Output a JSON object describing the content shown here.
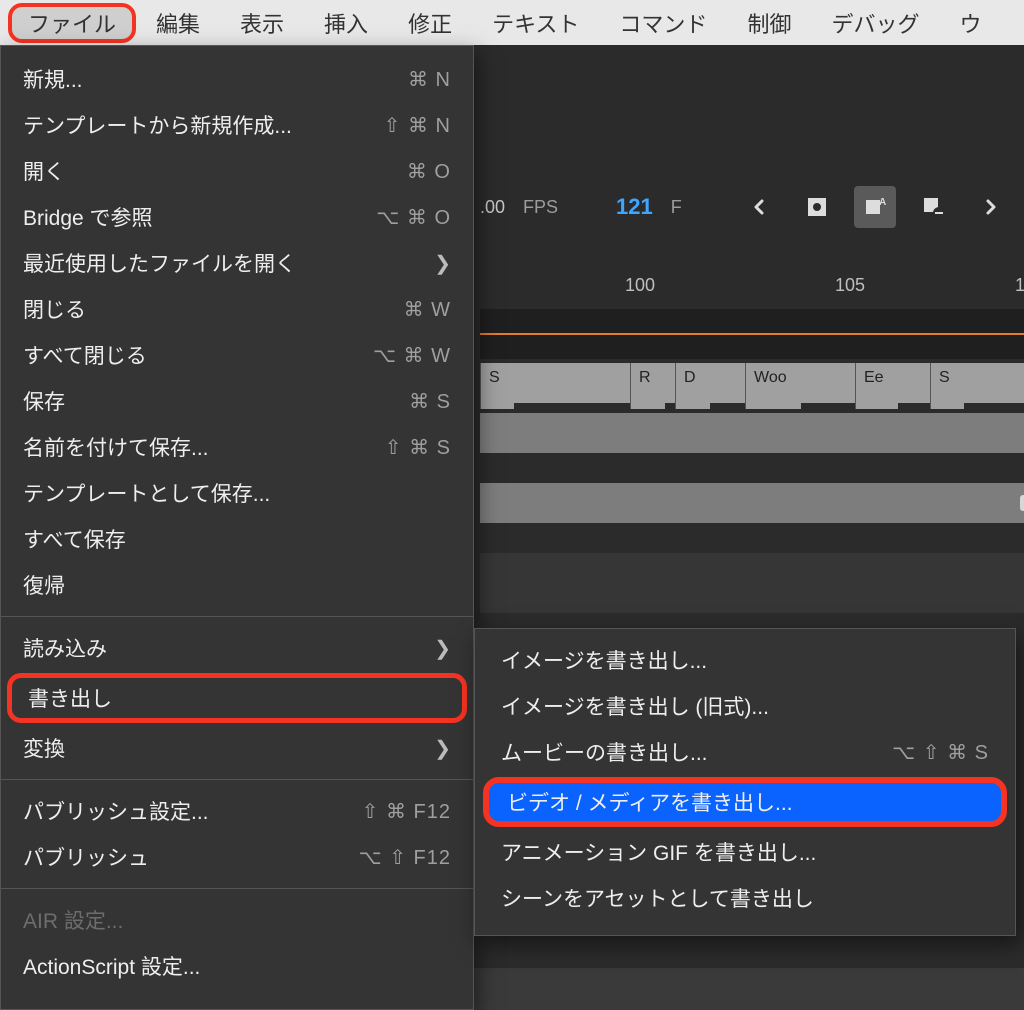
{
  "menuBar": {
    "items": [
      "ファイル",
      "編集",
      "表示",
      "挿入",
      "修正",
      "テキスト",
      "コマンド",
      "制御",
      "デバッグ",
      "ウ"
    ]
  },
  "timeline": {
    "fpsValue": ".00",
    "fpsLabel": "FPS",
    "frameValue": "121",
    "frameLabel": "F",
    "ruler": {
      "t100": "100",
      "t105": "105",
      "t110": "1"
    },
    "markers": {
      "m0": "S",
      "m1": "R",
      "m2": "D",
      "m3": "Woo",
      "m4": "Ee",
      "m5": "S"
    }
  },
  "fileMenu": {
    "new": "新規...",
    "newSC": "⌘ N",
    "newFromTemplate": "テンプレートから新規作成...",
    "newFromTemplateSC": "⇧ ⌘ N",
    "open": "開く",
    "openSC": "⌘ O",
    "bridge": "Bridge で参照",
    "bridgeSC": "⌥ ⌘ O",
    "recent": "最近使用したファイルを開く",
    "close": "閉じる",
    "closeSC": "⌘ W",
    "closeAll": "すべて閉じる",
    "closeAllSC": "⌥ ⌘ W",
    "save": "保存",
    "saveSC": "⌘ S",
    "saveAs": "名前を付けて保存...",
    "saveAsSC": "⇧ ⌘ S",
    "saveTemplate": "テンプレートとして保存...",
    "saveAll": "すべて保存",
    "revert": "復帰",
    "import": "読み込み",
    "export": "書き出し",
    "convert": "変換",
    "publishSettings": "パブリッシュ設定...",
    "publishSettingsSC": "⇧ ⌘ F12",
    "publish": "パブリッシュ",
    "publishSC": "⌥ ⇧ F12",
    "airSettings": "AIR 設定...",
    "asSettings": "ActionScript 設定..."
  },
  "exportMenu": {
    "exportImage": "イメージを書き出し...",
    "exportImageLegacy": "イメージを書き出し (旧式)...",
    "exportMovie": "ムービーの書き出し...",
    "exportMovieSC": "⌥ ⇧ ⌘ S",
    "exportVideo": "ビデオ / メディアを書き出し...",
    "exportGIF": "アニメーション GIF を書き出し...",
    "exportSceneAsset": "シーンをアセットとして書き出し"
  }
}
